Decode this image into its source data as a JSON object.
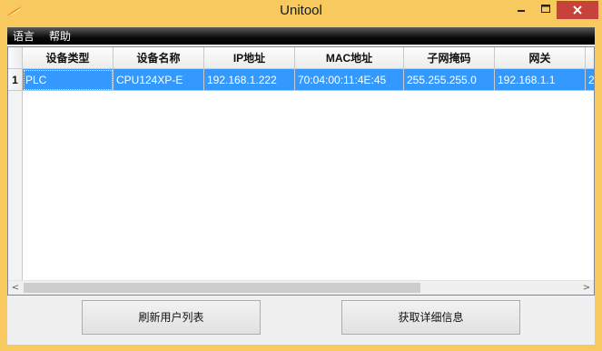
{
  "window": {
    "title": "Unitool"
  },
  "menu": {
    "items": [
      "语言",
      "帮助"
    ]
  },
  "table": {
    "columns": [
      "设备类型",
      "设备名称",
      "IP地址",
      "MAC地址",
      "子网掩码",
      "网关",
      ""
    ],
    "rows": [
      {
        "num": "1",
        "cells": [
          "PLC",
          "CPU124XP-E",
          "192.168.1.222",
          "70:04:00:11:4E:45",
          "255.255.255.0",
          "192.168.1.1",
          "2."
        ]
      }
    ]
  },
  "scrollbar": {
    "left_arrow": "<",
    "right_arrow": ">"
  },
  "buttons": {
    "refresh": "刷新用户列表",
    "details": "获取详细信息"
  },
  "colors": {
    "frame": "#f7c95e",
    "close": "#c7423a",
    "selection": "#3399ff"
  }
}
